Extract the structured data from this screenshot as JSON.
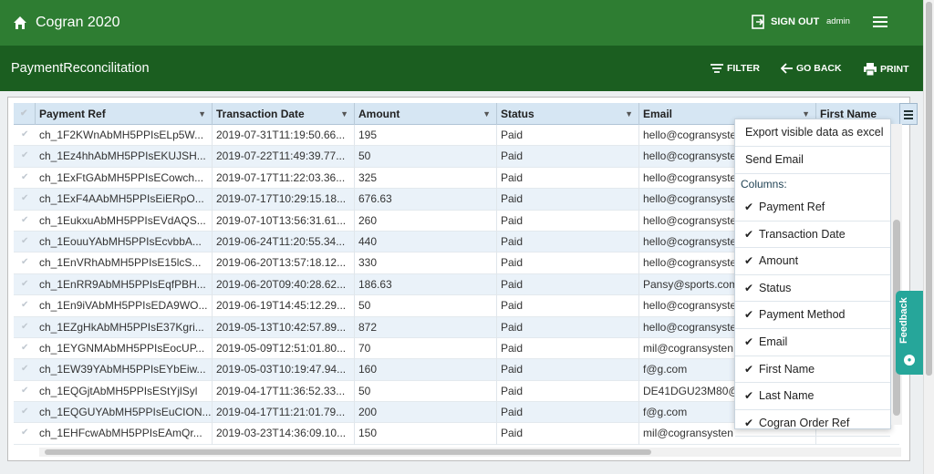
{
  "app": {
    "title": "Cogran 2020",
    "sign_out": "SIGN OUT",
    "user": "admin"
  },
  "page": {
    "title": "PaymentReconcilitation"
  },
  "toolbar": {
    "filter": "FILTER",
    "go_back": "GO BACK",
    "print": "PRINT"
  },
  "grid": {
    "columns": [
      "Payment Ref",
      "Transaction Date",
      "Amount",
      "Status",
      "Email",
      "First Name"
    ],
    "rows": [
      [
        "ch_1F2KWnAbMH5PPIsELp5W...",
        "2019-07-31T11:19:50.66...",
        "195",
        "Paid",
        "hello@cogransyste"
      ],
      [
        "ch_1Ez4hhAbMH5PPIsEKUJSH...",
        "2019-07-22T11:49:39.77...",
        "50",
        "Paid",
        "hello@cogransyste"
      ],
      [
        "ch_1ExFtGAbMH5PPIsECowch...",
        "2019-07-17T11:22:03.36...",
        "325",
        "Paid",
        "hello@cogransyste"
      ],
      [
        "ch_1ExF4AAbMH5PPIsEiERpO...",
        "2019-07-17T10:29:15.18...",
        "676.63",
        "Paid",
        "hello@cogransyste"
      ],
      [
        "ch_1EukxuAbMH5PPIsEVdAQS...",
        "2019-07-10T13:56:31.61...",
        "260",
        "Paid",
        "hello@cogransyste"
      ],
      [
        "ch_1EouuYAbMH5PPIsEcvbbA...",
        "2019-06-24T11:20:55.34...",
        "440",
        "Paid",
        "hello@cogransyste"
      ],
      [
        "ch_1EnVRhAbMH5PPIsE15lcS...",
        "2019-06-20T13:57:18.12...",
        "330",
        "Paid",
        "hello@cogransyste"
      ],
      [
        "ch_1EnRR9AbMH5PPIsEqfPBH...",
        "2019-06-20T09:40:28.62...",
        "186.63",
        "Paid",
        "Pansy@sports.com"
      ],
      [
        "ch_1En9iVAbMH5PPIsEDA9WO...",
        "2019-06-19T14:45:12.29...",
        "50",
        "Paid",
        "hello@cogransyste"
      ],
      [
        "ch_1EZgHkAbMH5PPIsE37Kgri...",
        "2019-05-13T10:42:57.89...",
        "872",
        "Paid",
        "hello@cogransyste"
      ],
      [
        "ch_1EYGNMAbMH5PPIsEocUP...",
        "2019-05-09T12:51:01.80...",
        "70",
        "Paid",
        "mil@cogransysten"
      ],
      [
        "ch_1EW39YAbMH5PPIsEYbEiw...",
        "2019-05-03T10:19:47.94...",
        "160",
        "Paid",
        "f@g.com"
      ],
      [
        "ch_1EQGjtAbMH5PPIsEStYjlSyl",
        "2019-04-17T11:36:52.33...",
        "50",
        "Paid",
        "DE41DGU23M80@"
      ],
      [
        "ch_1EQGUYAbMH5PPIsEuCION...",
        "2019-04-17T11:21:01.79...",
        "200",
        "Paid",
        "f@g.com"
      ],
      [
        "ch_1EHFcwAbMH5PPIsEAmQr...",
        "2019-03-23T14:36:09.10...",
        "150",
        "Paid",
        "mil@cogransysten"
      ]
    ]
  },
  "menu": {
    "export": "Export visible data as excel",
    "send_email": "Send Email",
    "columns_label": "Columns:",
    "columns": [
      "Payment Ref",
      "Transaction Date",
      "Amount",
      "Status",
      "Payment Method",
      "Email",
      "First Name",
      "Last Name",
      "Cogran Order Ref"
    ],
    "check": "✔"
  },
  "feedback": {
    "label": "Feedback"
  },
  "colors": {
    "topbar": "#2e7d32",
    "subbar": "#1b5e20",
    "header": "#d6e6f3",
    "alt_row": "#eaf2f9",
    "feedback": "#26a69a"
  }
}
